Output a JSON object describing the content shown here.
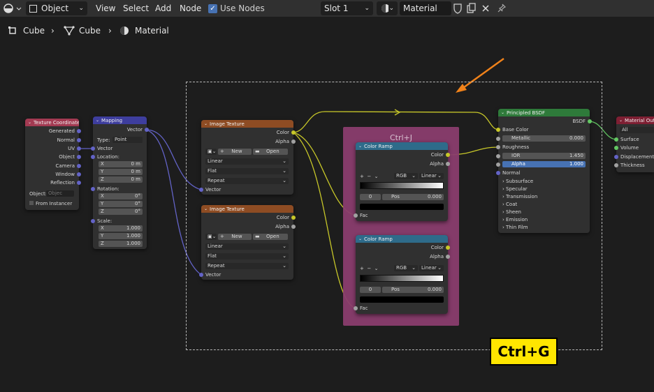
{
  "header": {
    "mode": "Object",
    "menus": [
      "View",
      "Select",
      "Add",
      "Node"
    ],
    "use_nodes_label": "Use Nodes",
    "use_nodes_checked": true,
    "slot": "Slot 1",
    "material": "Material"
  },
  "breadcrumb": [
    "Cube",
    "Cube",
    "Material"
  ],
  "frame_label": "Ctrl+J",
  "shortcut_badge": "Ctrl+G",
  "nodes": {
    "texcoord": {
      "title": "Texture Coordinate",
      "outputs": [
        "Generated",
        "Normal",
        "UV",
        "Object",
        "Camera",
        "Window",
        "Reflection"
      ],
      "object_label": "Object:",
      "object_value": "Objec",
      "instancer": "From Instancer"
    },
    "mapping": {
      "title": "Mapping",
      "output": "Vector",
      "type_label": "Type:",
      "type_value": "Point",
      "vector": "Vector",
      "location": "Location:",
      "rotation": "Rotation:",
      "scale": "Scale:",
      "axes": [
        "X",
        "Y",
        "Z"
      ],
      "loc": [
        "0 m",
        "0 m",
        "0 m"
      ],
      "rot": [
        "0°",
        "0°",
        "0°"
      ],
      "scl": [
        "1.000",
        "1.000",
        "1.000"
      ]
    },
    "imgtex1": {
      "title": "Image Texture",
      "color": "Color",
      "alpha": "Alpha",
      "new": "New",
      "open": "Open",
      "interp": "Linear",
      "proj": "Flat",
      "ext": "Repeat",
      "vector": "Vector"
    },
    "imgtex2": {
      "title": "Image Texture",
      "color": "Color",
      "alpha": "Alpha",
      "new": "New",
      "open": "Open",
      "interp": "Linear",
      "proj": "Flat",
      "ext": "Repeat",
      "vector": "Vector"
    },
    "ramp1": {
      "title": "Color Ramp",
      "color": "Color",
      "alpha": "Alpha",
      "mode": "RGB",
      "interp": "Linear",
      "index": "0",
      "pos_label": "Pos",
      "pos": "0.000",
      "fac": "Fac"
    },
    "ramp2": {
      "title": "Color Ramp",
      "color": "Color",
      "alpha": "Alpha",
      "mode": "RGB",
      "interp": "Linear",
      "index": "0",
      "pos_label": "Pos",
      "pos": "0.000",
      "fac": "Fac"
    },
    "bsdf": {
      "title": "Principled BSDF",
      "output": "BSDF",
      "base_color": "Base Color",
      "metallic": "Metallic",
      "metallic_val": "0.000",
      "roughness": "Roughness",
      "ior": "IOR",
      "ior_val": "1.450",
      "alpha": "Alpha",
      "alpha_val": "1.000",
      "normal": "Normal",
      "panels": [
        "Subsurface",
        "Specular",
        "Transmission",
        "Coat",
        "Sheen",
        "Emission",
        "Thin Film"
      ]
    },
    "output": {
      "title": "Material Output",
      "target": "All",
      "inputs": [
        "Surface",
        "Volume",
        "Displacement",
        "Thickness"
      ]
    }
  },
  "colors": {
    "socket_color": "#c7c729",
    "socket_vector": "#6363c7",
    "socket_float": "#a1a1a1",
    "socket_shader": "#63c763",
    "input_header": "#a33a52",
    "vector_header": "#3e3e9e",
    "texture_header": "#8e4c23",
    "converter_header": "#2e6b8a",
    "shader_header": "#2e7a3a",
    "output_header": "#7e1f33",
    "frame": "#8a3d6e",
    "badge": "#ffe600",
    "arrow": "#f0821a"
  }
}
